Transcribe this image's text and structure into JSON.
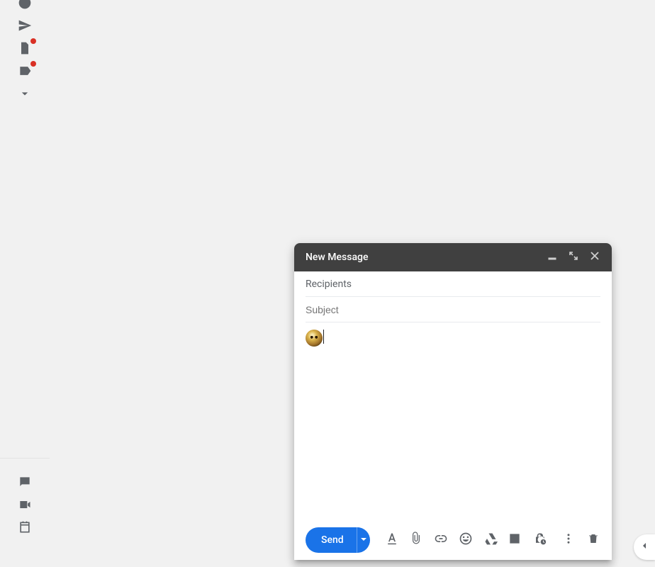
{
  "sidebar": {
    "top_items": [
      {
        "name": "snoozed",
        "icon": "clock",
        "has_badge": false
      },
      {
        "name": "sent",
        "icon": "send",
        "has_badge": false
      },
      {
        "name": "drafts",
        "icon": "file",
        "has_badge": true
      },
      {
        "name": "category",
        "icon": "label",
        "has_badge": true
      },
      {
        "name": "more",
        "icon": "expand",
        "has_badge": false
      }
    ],
    "bottom_items": [
      {
        "name": "chat",
        "icon": "chat-bubble"
      },
      {
        "name": "meet",
        "icon": "videocam"
      },
      {
        "name": "rooms",
        "icon": "calendar"
      }
    ]
  },
  "compose": {
    "title": "New Message",
    "recipients_placeholder": "Recipients",
    "subject_placeholder": "Subject",
    "recipients_value": "",
    "subject_value": "",
    "body_emoji_alt": "emoji",
    "send_label": "Send",
    "toolbar_icons": [
      "formatting",
      "attach",
      "link",
      "emoji",
      "drive",
      "image",
      "confidential"
    ],
    "trailing_icons": [
      "more",
      "discard"
    ]
  },
  "panel_toggle_label": "Show side panel"
}
